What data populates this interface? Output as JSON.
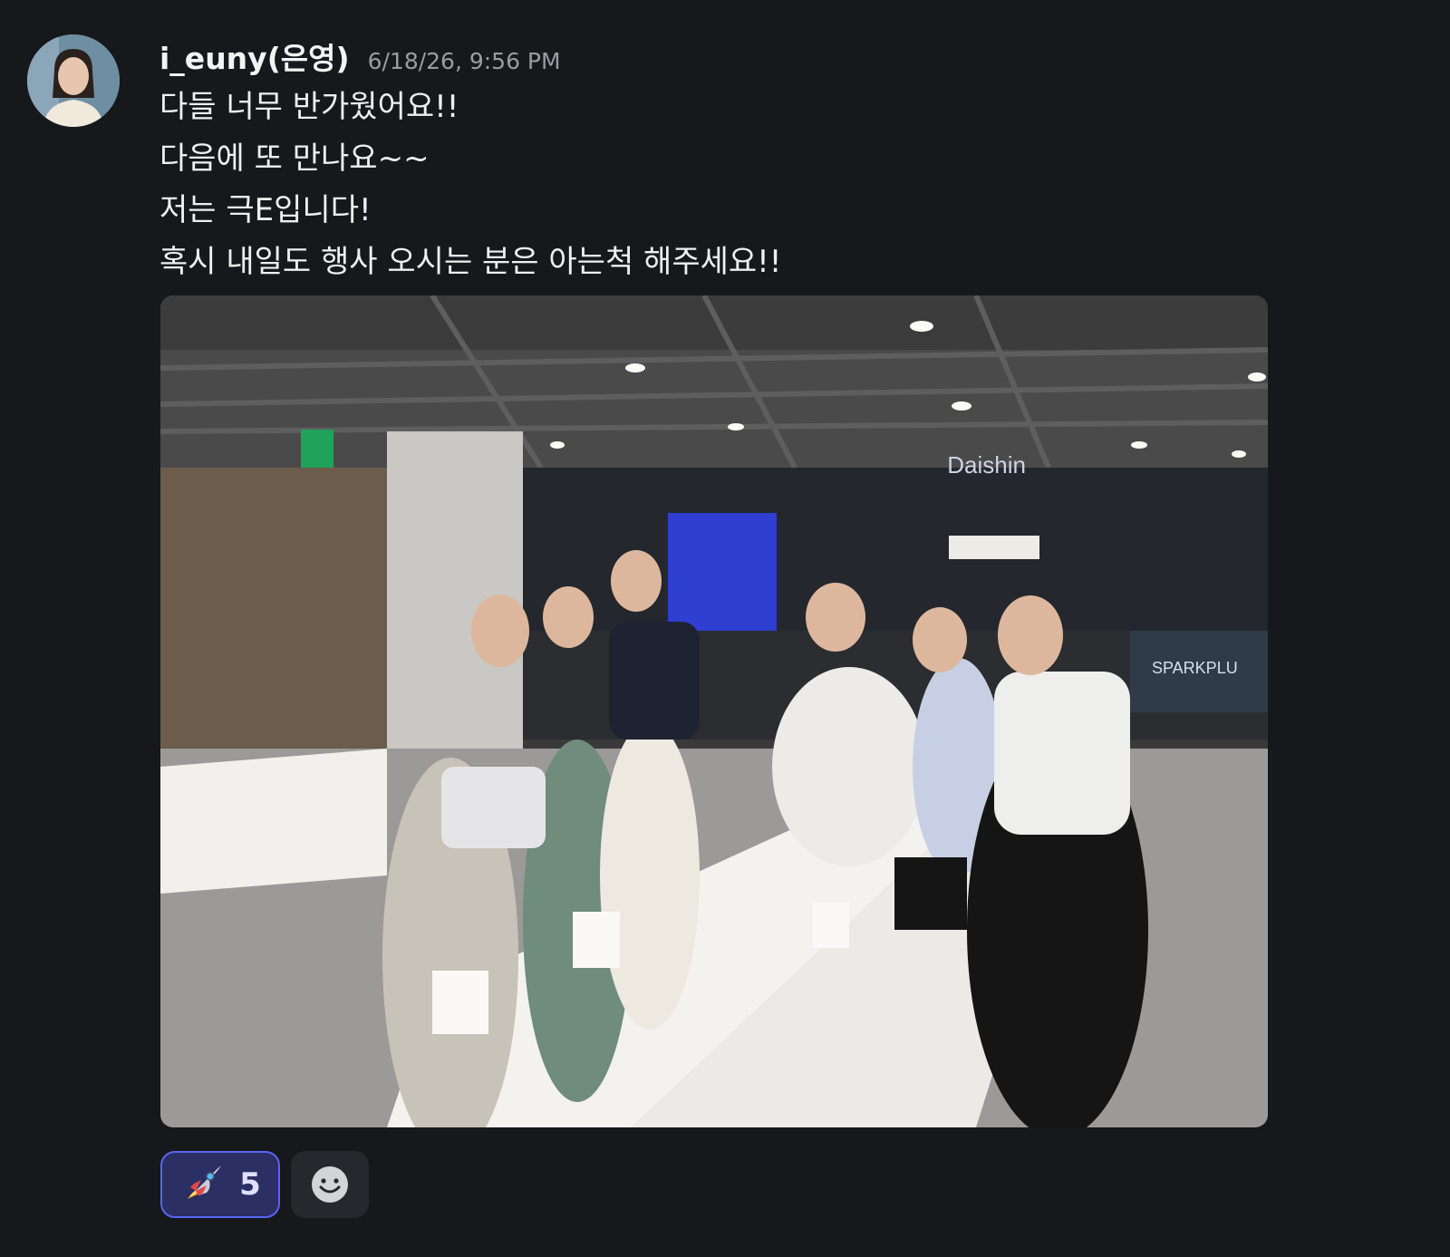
{
  "message": {
    "author": {
      "username": "i_euny(은영)",
      "avatar": "avatar-photo"
    },
    "timestamp": "6/18/26, 9:56 PM",
    "lines": [
      "다들 너무 반가웠어요!!",
      "다음에 또 만나요~~",
      "저는 극E입니다!",
      "혹시 내일도 행사 오시는 분은 아는척 해주세요!!"
    ],
    "attachment": {
      "type": "image",
      "signs": {
        "top": "Daishin",
        "right": "SPARKPLU"
      }
    },
    "reactions": [
      {
        "emoji_icon": "rocket-icon",
        "count": "5",
        "selected": true
      }
    ],
    "add_reaction_icon": "smiley-add-icon"
  },
  "colors": {
    "background": "#17181c",
    "reaction_accent": "#5865f2",
    "reaction_bg": "#2b2f63"
  }
}
